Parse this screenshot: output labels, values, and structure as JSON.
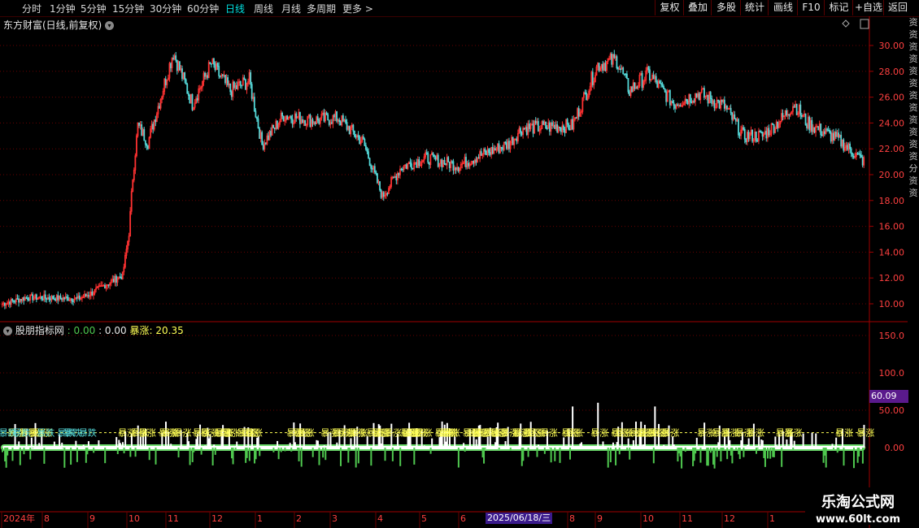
{
  "topbar": {
    "periods": [
      "分时",
      "1分钟",
      "5分钟",
      "15分钟",
      "30分钟",
      "60分钟",
      "日线",
      "周线",
      "月线",
      "多周期",
      "更多 >"
    ],
    "active_period": "日线",
    "buttons": [
      "复权",
      "叠加",
      "多股",
      "统计",
      "画线",
      "F10",
      "标记",
      "+自选",
      "返回"
    ]
  },
  "main": {
    "title": "东方财富(日线,前复权)",
    "y_ticks": [
      "30.00",
      "28.00",
      "26.00",
      "24.00",
      "22.00",
      "20.00",
      "18.00",
      "16.00",
      "14.00",
      "12.00",
      "10.00"
    ]
  },
  "indicator": {
    "name": "股朋指标网",
    "val1": ": 0.00",
    "val2": ": 0.00",
    "label3": "暴涨",
    "val3": ": 20.35",
    "y_ticks": [
      "150.0",
      "100.0",
      "50.00",
      "0.00"
    ],
    "current_value": "60.09",
    "signal_up": "暴涨",
    "signal_down": "暴跌"
  },
  "x_axis": {
    "labels": [
      "2024年",
      "8",
      "9",
      "10",
      "11",
      "12",
      "1",
      "2",
      "3",
      "4",
      "5",
      "6",
      "8",
      "9",
      "10",
      "11",
      "12",
      "1"
    ],
    "selected_date": "2025/06/18/三"
  },
  "sidebar": {
    "chars": "资资资资资资资资资资资资分资资"
  },
  "watermark": {
    "line1": "乐淘公式网",
    "line2": "www.60lt.com"
  },
  "colors": {
    "up": "#ff3232",
    "down": "#54d8d8",
    "bar_up": "#ffffff",
    "bar_down": "#4fc84f",
    "signal": "#ffff55",
    "axis": "#a00000"
  },
  "chart_data": {
    "type": "candlestick",
    "price_key_points": [
      [
        0,
        10.0
      ],
      [
        20,
        10.5
      ],
      [
        60,
        10.4
      ],
      [
        70,
        10.8
      ],
      [
        80,
        11.4
      ],
      [
        95,
        12.2
      ],
      [
        100,
        15.5
      ],
      [
        103,
        19.8
      ],
      [
        107,
        23.8
      ],
      [
        115,
        22.5
      ],
      [
        135,
        29.5
      ],
      [
        150,
        25.5
      ],
      [
        165,
        28.6
      ],
      [
        180,
        26.5
      ],
      [
        195,
        27.3
      ],
      [
        205,
        22.3
      ],
      [
        222,
        24.6
      ],
      [
        245,
        24.2
      ],
      [
        265,
        24.4
      ],
      [
        285,
        22.5
      ],
      [
        300,
        18.3
      ],
      [
        315,
        20.6
      ],
      [
        335,
        21.3
      ],
      [
        360,
        20.7
      ],
      [
        375,
        21.4
      ],
      [
        400,
        22.4
      ],
      [
        410,
        23.6
      ],
      [
        430,
        23.7
      ],
      [
        450,
        23.8
      ],
      [
        470,
        28.5
      ],
      [
        485,
        28.9
      ],
      [
        495,
        26.5
      ],
      [
        510,
        27.8
      ],
      [
        530,
        25.5
      ],
      [
        550,
        26.3
      ],
      [
        570,
        25.3
      ],
      [
        585,
        23.0
      ],
      [
        600,
        23.0
      ],
      [
        615,
        24.3
      ],
      [
        625,
        25.5
      ],
      [
        635,
        24.0
      ],
      [
        660,
        22.7
      ],
      [
        680,
        21.0
      ]
    ],
    "price_range": [
      9.2,
      31.0
    ],
    "indicator_range": [
      -70,
      160
    ]
  }
}
